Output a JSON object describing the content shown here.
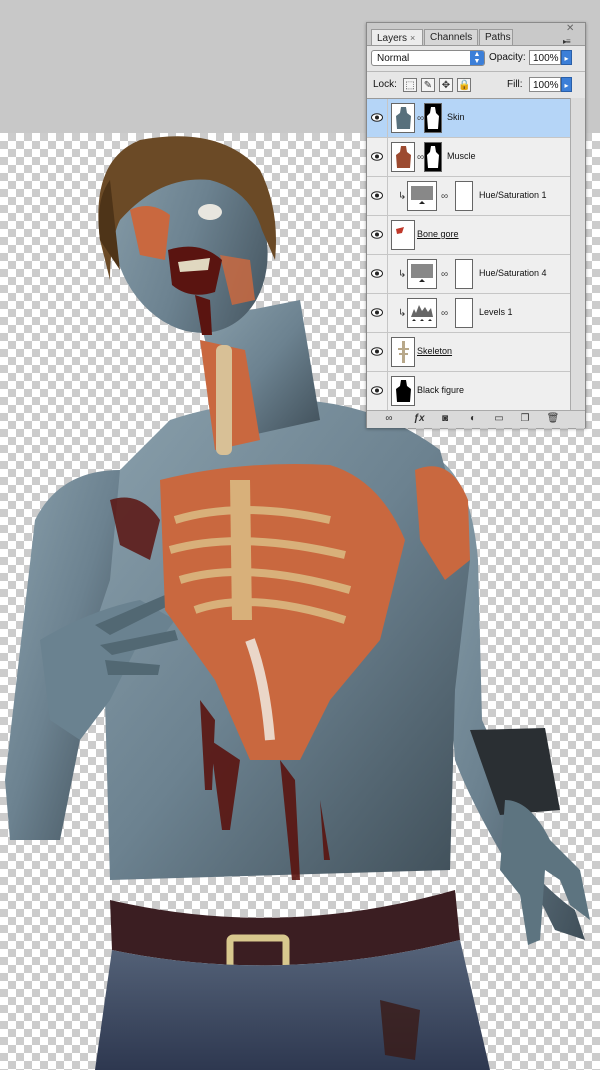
{
  "panel": {
    "tabs": [
      {
        "label": "Layers",
        "active": true
      },
      {
        "label": "Channels",
        "active": false
      },
      {
        "label": "Paths",
        "active": false
      }
    ],
    "tab_close": "×",
    "blend_mode": "Normal",
    "opacity_label": "Opacity:",
    "opacity_value": "100%",
    "lock_label": "Lock:",
    "fill_label": "Fill:",
    "fill_value": "100%"
  },
  "layers": [
    {
      "name": "Skin",
      "selected": true,
      "underlined": false,
      "type": "pixel-mask"
    },
    {
      "name": "Muscle",
      "selected": false,
      "underlined": false,
      "type": "pixel-mask"
    },
    {
      "name": "Hue/Saturation 1",
      "selected": false,
      "underlined": false,
      "type": "adjustment"
    },
    {
      "name": "Bone gore",
      "selected": false,
      "underlined": true,
      "type": "pixel"
    },
    {
      "name": "Hue/Saturation 4",
      "selected": false,
      "underlined": false,
      "type": "adjustment"
    },
    {
      "name": "Levels 1",
      "selected": false,
      "underlined": false,
      "type": "levels"
    },
    {
      "name": "Skeleton",
      "selected": false,
      "underlined": true,
      "type": "pixel"
    },
    {
      "name": "Black figure",
      "selected": false,
      "underlined": false,
      "type": "pixel"
    }
  ],
  "bottom_icons": [
    "link-icon",
    "fx-icon",
    "mask-icon",
    "adjustment-icon",
    "folder-icon",
    "new-layer-icon",
    "trash-icon"
  ],
  "colors": {
    "selection": "#b5d5f7",
    "skin": "#6c8290",
    "muscle": "#c9683f",
    "hair": "#6b4a26",
    "blood": "#5a1410",
    "jeans": "#3d4a63"
  }
}
